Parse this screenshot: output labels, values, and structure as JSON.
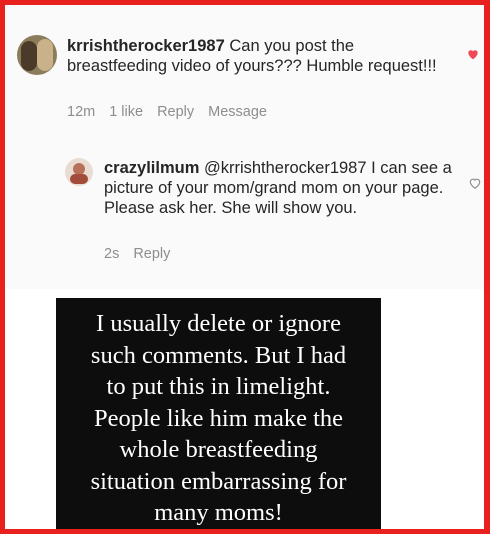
{
  "comment1": {
    "username": "krrishtherocker1987",
    "text": " Can you post the breastfeeding video of yours??? Humble request!!!",
    "time": "12m",
    "likes": "1 like",
    "reply_label": "Reply",
    "message_label": "Message",
    "heart_color": "#ed4956"
  },
  "comment2": {
    "username": "crazylilmum",
    "text": " @krrishtherocker1987 I can see a picture of your mom/grand mom on your page. Please ask her. She will show you.",
    "time": "2s",
    "reply_label": "Reply"
  },
  "quote": {
    "text": "I usually delete or ignore\nsuch comments. But I had\nto put this in limelight.\nPeople like him make the\nwhole breastfeeding\nsituation embarrassing for\nmany moms!"
  },
  "colors": {
    "border": "#e8201e",
    "quote_bg": "#0d0d0d"
  }
}
